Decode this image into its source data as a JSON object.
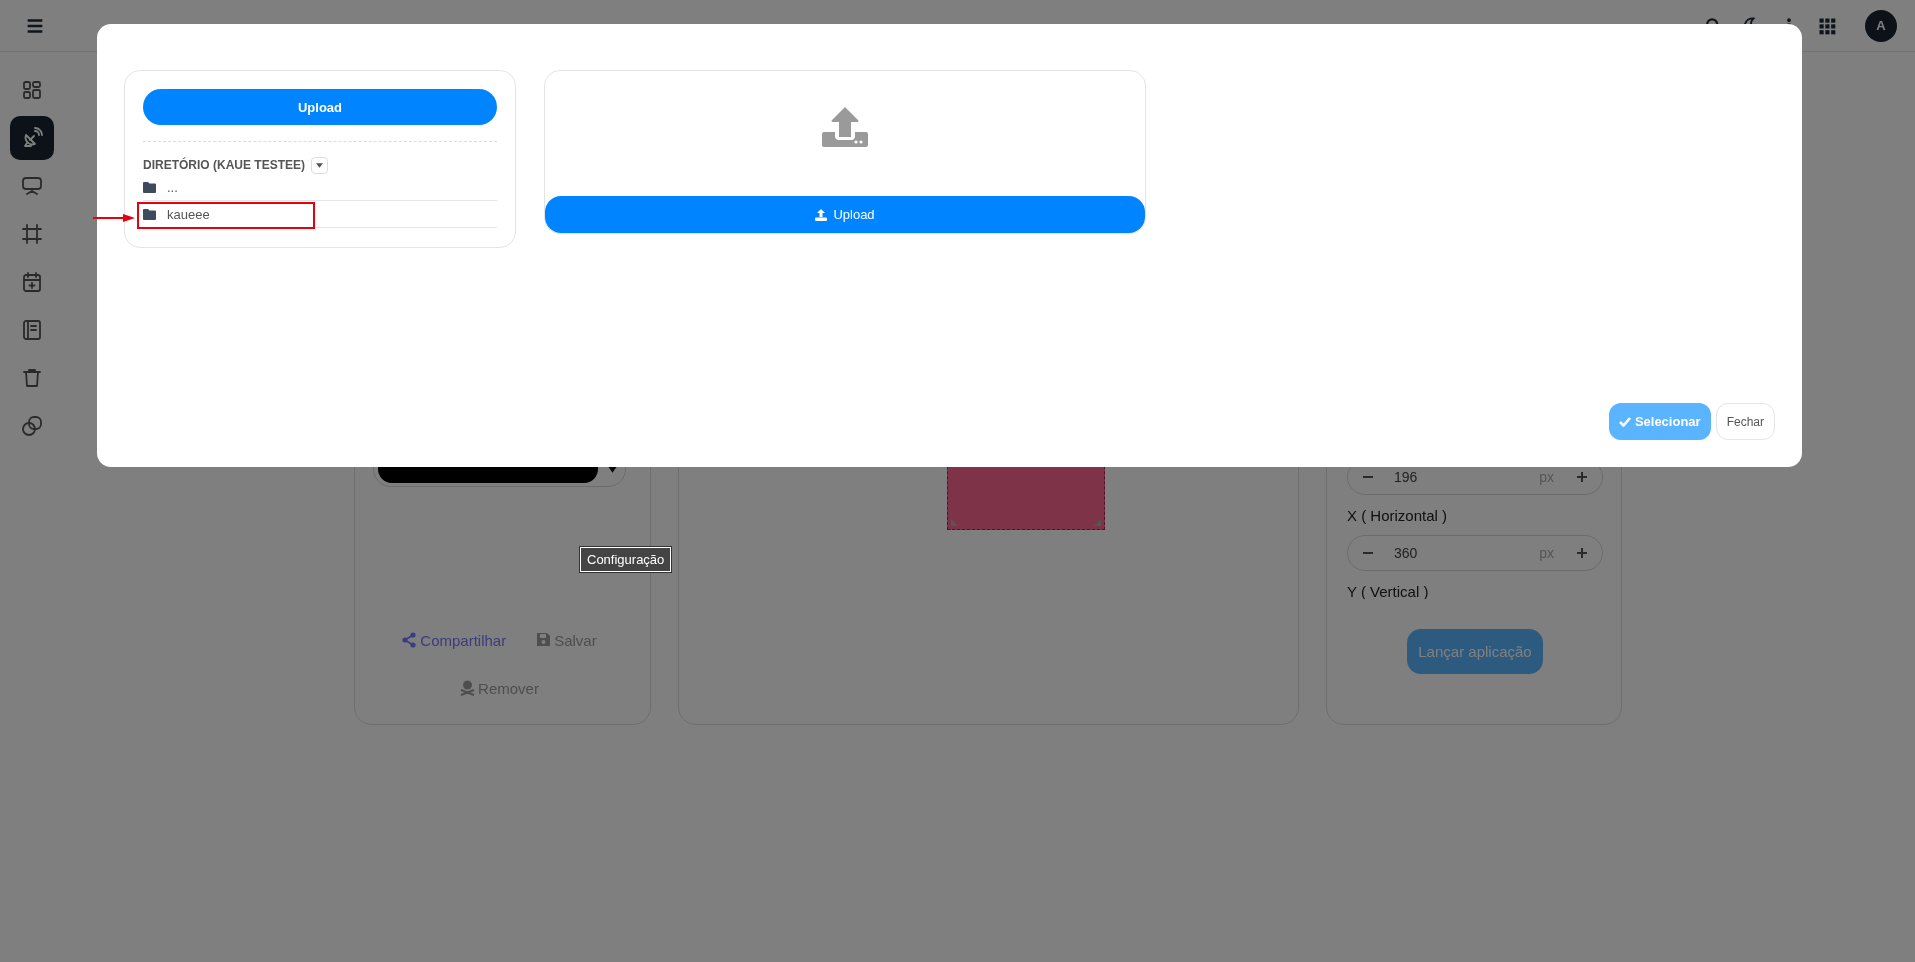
{
  "header": {
    "avatar": "A"
  },
  "sidebar": {
    "items": [
      {
        "kind": "dashboard",
        "selected": false
      },
      {
        "kind": "satellite",
        "selected": true
      },
      {
        "kind": "monitor",
        "selected": false
      },
      {
        "kind": "frame",
        "selected": false
      },
      {
        "kind": "calendar",
        "selected": false
      },
      {
        "kind": "book",
        "selected": false
      },
      {
        "kind": "trash",
        "selected": false
      },
      {
        "kind": "copy",
        "selected": false
      }
    ]
  },
  "workspace": {
    "actions": [
      {
        "kind": "share",
        "label": "Compartilhar",
        "disabled": false
      },
      {
        "kind": "save",
        "label": "Salvar",
        "disabled": true
      },
      {
        "kind": "remove",
        "label": "Remover",
        "disabled": true
      }
    ],
    "fields": [
      {
        "value": "196",
        "unit": "px"
      },
      {
        "label": "X ( Horizontal )",
        "value": "360",
        "unit": "px"
      },
      {
        "label": "Y ( Vertical )"
      }
    ],
    "launch_button": "Lançar aplicação"
  },
  "tooltip": "Configuração",
  "modal": {
    "directory": {
      "upload_button": "Upload",
      "title": "DIRETÓRIO (KAUE TESTEE)",
      "items": [
        {
          "name": "...",
          "annotated": false
        },
        {
          "name": "kaueee",
          "annotated": true
        }
      ]
    },
    "upload": {
      "button": "Upload"
    },
    "buttons": [
      {
        "kind": "primary",
        "label": "Selecionar"
      },
      {
        "kind": "secondary",
        "label": "Fechar"
      }
    ]
  }
}
